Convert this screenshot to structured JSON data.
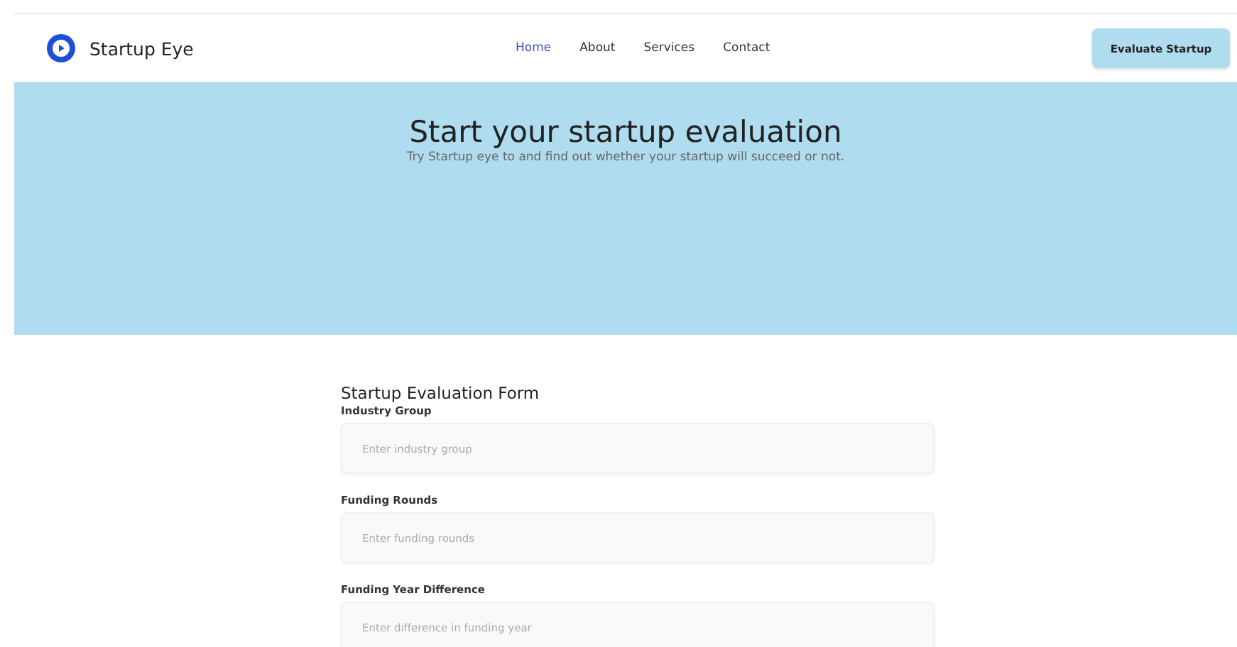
{
  "brand": {
    "name": "Startup Eye"
  },
  "nav": [
    {
      "label": "Home",
      "selected": true
    },
    {
      "label": "About",
      "selected": false
    },
    {
      "label": "Services",
      "selected": false
    },
    {
      "label": "Contact",
      "selected": false
    }
  ],
  "cta": "Evaluate Startup",
  "hero": {
    "title": "Start your startup evaluation",
    "subtitle": "Try Startup eye to and find out whether your startup will succeed or not."
  },
  "form": {
    "title": "Startup Evaluation Form",
    "fields": [
      {
        "label": "Industry Group",
        "placeholder": "Enter industry group"
      },
      {
        "label": "Funding Rounds",
        "placeholder": "Enter funding rounds"
      },
      {
        "label": "Funding Year Difference",
        "placeholder": "Enter difference in funding year"
      }
    ]
  }
}
